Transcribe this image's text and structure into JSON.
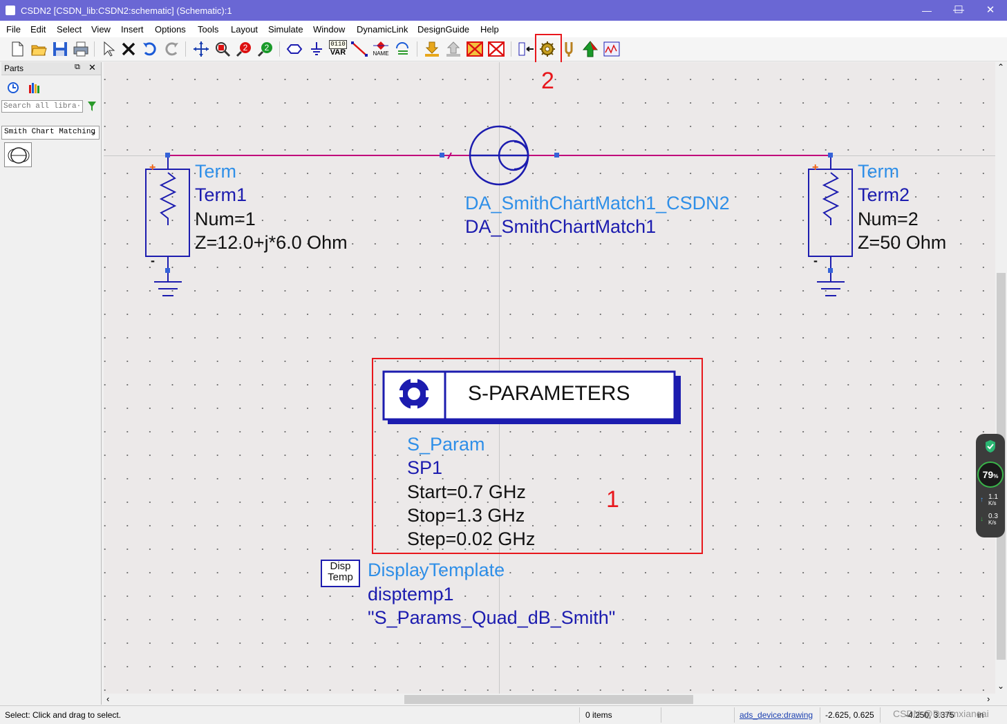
{
  "window": {
    "title": "CSDN2 [CSDN_lib:CSDN2:schematic] (Schematic):1",
    "minimize": "—",
    "maximize": "☐",
    "close": "✕"
  },
  "menu": [
    "File",
    "Edit",
    "Select",
    "View",
    "Insert",
    "Options",
    "Tools",
    "Layout",
    "Simulate",
    "Window",
    "DynamicLink",
    "DesignGuide",
    "Help"
  ],
  "toolbar": {
    "var_label_top": "0110",
    "var_label": "VAR",
    "name_label": "NAME"
  },
  "parts_panel": {
    "title": "Parts",
    "search_placeholder": "Search all libra···",
    "library": "Smith Chart Matching"
  },
  "schematic": {
    "term1": {
      "type": "Term",
      "name": "Term1",
      "num": "Num=1",
      "z": "Z=12.0+j*6.0 Ohm",
      "plus": "+",
      "minus": "-"
    },
    "term2": {
      "type": "Term",
      "name": "Term2",
      "num": "Num=2",
      "z": "Z=50 Ohm",
      "plus": "+",
      "minus": "-"
    },
    "smith": {
      "lib_name": "DA_SmithChartMatch1_CSDN2",
      "inst_name": "DA_SmithChartMatch1"
    },
    "sparam": {
      "header": "S-PARAMETERS",
      "type": "S_Param",
      "name": "SP1",
      "start": "Start=0.7 GHz",
      "stop": "Stop=1.3 GHz",
      "step": "Step=0.02 GHz"
    },
    "disptemp": {
      "box_line1": "Disp",
      "box_line2": "Temp",
      "type": "DisplayTemplate",
      "name": "disptemp1",
      "value": "\"S_Params_Quad_dB_Smith\""
    }
  },
  "annotations": {
    "note1": "1",
    "note2": "2"
  },
  "status": {
    "hint": "Select: Click and drag to select.",
    "items": "0 items",
    "layer": "ads_device:drawing",
    "coords": "-2.625, 0.625",
    "coords2": "-4.250, 3.375",
    "units": "in",
    "watermark": "CSDN @Dreimxiancai"
  },
  "net_widget": {
    "percent": "79",
    "pct_sign": "%",
    "up": "1.1",
    "up_unit": "K/s",
    "down": "0.3",
    "down_unit": "K/s"
  },
  "colors": {
    "titlebar": "#6a67d4",
    "wire": "#c0007a",
    "component": "#1c1caf",
    "label_type": "#2f8fe8",
    "highlight": "#e8171c"
  }
}
